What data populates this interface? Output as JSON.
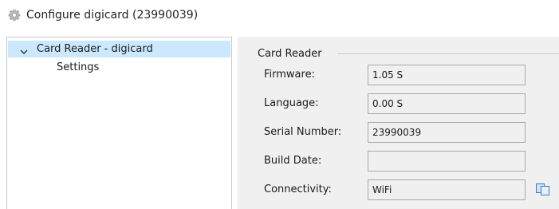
{
  "window": {
    "title": "Configure digicard (23990039)",
    "icon": "gear-icon"
  },
  "tree": {
    "node_label": "Card Reader - digicard",
    "expanded": true,
    "child_label": "Settings",
    "selected_color": "#cce8ff"
  },
  "card_reader": {
    "group_label": "Card Reader",
    "fields": [
      {
        "label": "Firmware:",
        "value": "1.05 S"
      },
      {
        "label": "Language:",
        "value": "0.00 S"
      },
      {
        "label": "Serial Number:",
        "value": "23990039"
      },
      {
        "label": "Build Date:",
        "value": ""
      },
      {
        "label": "Connectivity:",
        "value": "WiFi"
      }
    ],
    "copy_icon": "copy-icon"
  }
}
